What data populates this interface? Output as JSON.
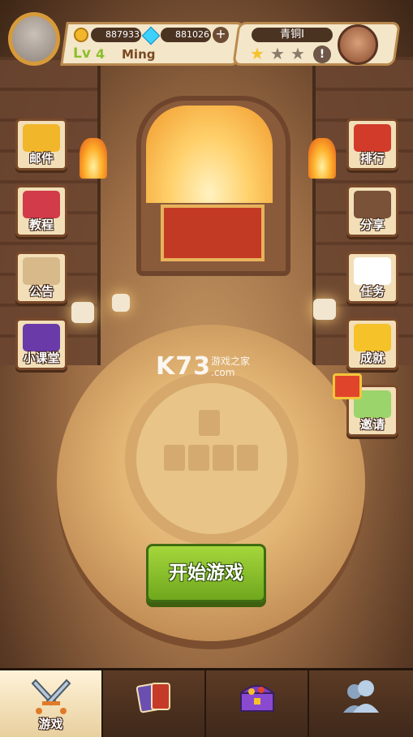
{
  "header": {
    "gold": "887933",
    "gems": "881026",
    "level_prefix": "Lv",
    "level": "4",
    "player_name": "Ming",
    "rank": "青铜I",
    "plus_symbol": "+",
    "alert_symbol": "!"
  },
  "left_menu": [
    {
      "label": "邮件",
      "icon": "mail-icon",
      "color": "#f2b62a"
    },
    {
      "label": "教程",
      "icon": "tv-icon",
      "color": "#d23b4a"
    },
    {
      "label": "公告",
      "icon": "scroll-icon",
      "color": "#d8b98a"
    },
    {
      "label": "小课堂",
      "icon": "book-icon",
      "color": "#6a3aa8"
    }
  ],
  "right_menu": [
    {
      "label": "排行",
      "icon": "crown-ribbon-icon",
      "color": "#d23b2a"
    },
    {
      "label": "分享",
      "icon": "share-icon",
      "color": "#7a5238"
    },
    {
      "label": "任务",
      "icon": "scroll-quest-icon",
      "color": "#ffffff"
    },
    {
      "label": "成就",
      "icon": "crown-icon",
      "color": "#f5c22a"
    },
    {
      "label": "邀请",
      "icon": "friends-icon",
      "color": "#9bd46a"
    }
  ],
  "start_button": "开始游戏",
  "watermark": {
    "big": "K73",
    "small_top": "游戏之家",
    "small_bottom": ".com"
  },
  "bottom_nav": [
    {
      "label": "游戏",
      "icon": "crossed-swords-icon",
      "active": true
    },
    {
      "label": "",
      "icon": "cards-icon",
      "active": false
    },
    {
      "label": "",
      "icon": "treasure-chest-icon",
      "active": false
    },
    {
      "label": "",
      "icon": "social-icon",
      "active": false
    }
  ]
}
